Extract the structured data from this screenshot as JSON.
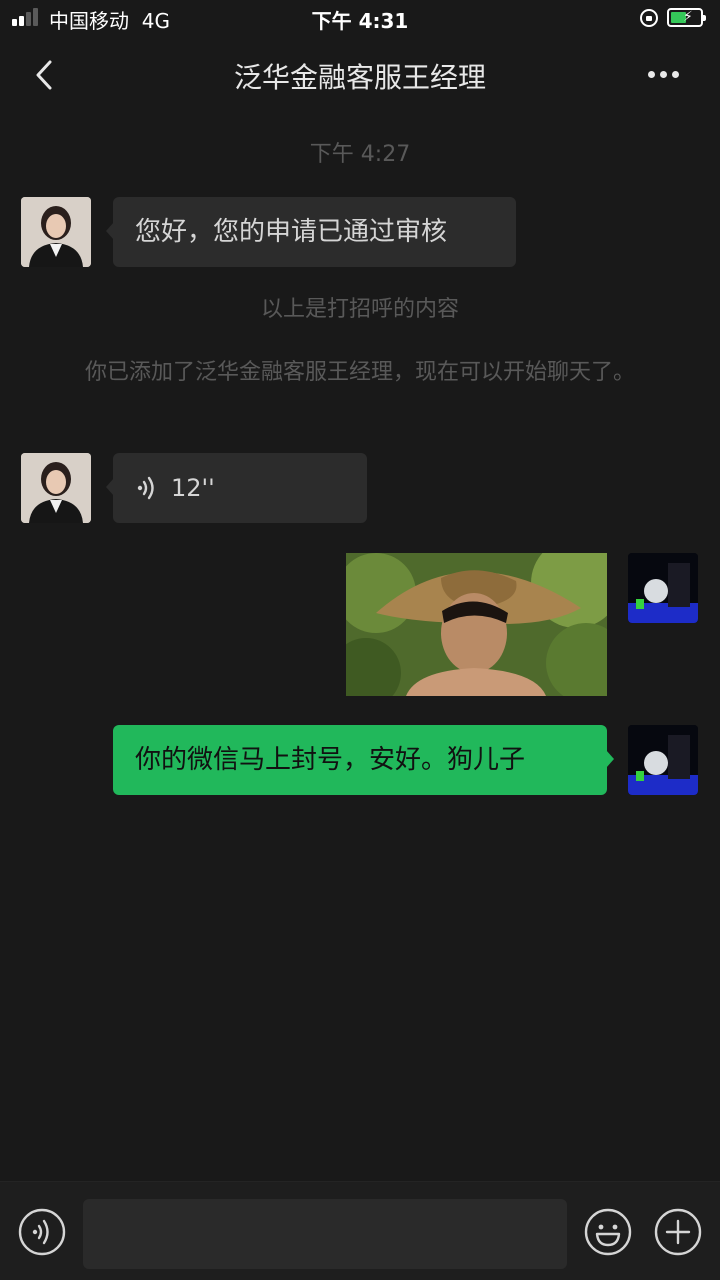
{
  "status_bar": {
    "carrier": "中国移动",
    "network": "4G",
    "time": "下午 4:31",
    "battery_level": 0.55,
    "icons": [
      "signal-icon",
      "orientation-lock-icon",
      "battery-charging-icon"
    ]
  },
  "nav": {
    "title": "泛华金融客服王经理",
    "icons": [
      "back-icon",
      "more-icon"
    ]
  },
  "chat": {
    "time_stamp": "下午 4:27",
    "greeting_message": "您好，您的申请已通过审核",
    "greeting_note": "以上是打招呼的内容",
    "added_note": "你已添加了泛华金融客服王经理，现在可以开始聊天了。",
    "voice_message": {
      "duration": "12''",
      "icon": "voice-wave-icon"
    },
    "image_message": {
      "kind": "photo"
    },
    "sent_message": "你的微信马上封号，安好。狗儿子"
  },
  "input_bar": {
    "value": "",
    "icons": [
      "voice-input-icon",
      "emoji-icon",
      "add-icon"
    ]
  },
  "colors": {
    "background": "#191919",
    "incoming_bubble": "#2c2c2c",
    "outgoing_bubble": "#21b85b",
    "system_text": "#595959"
  }
}
